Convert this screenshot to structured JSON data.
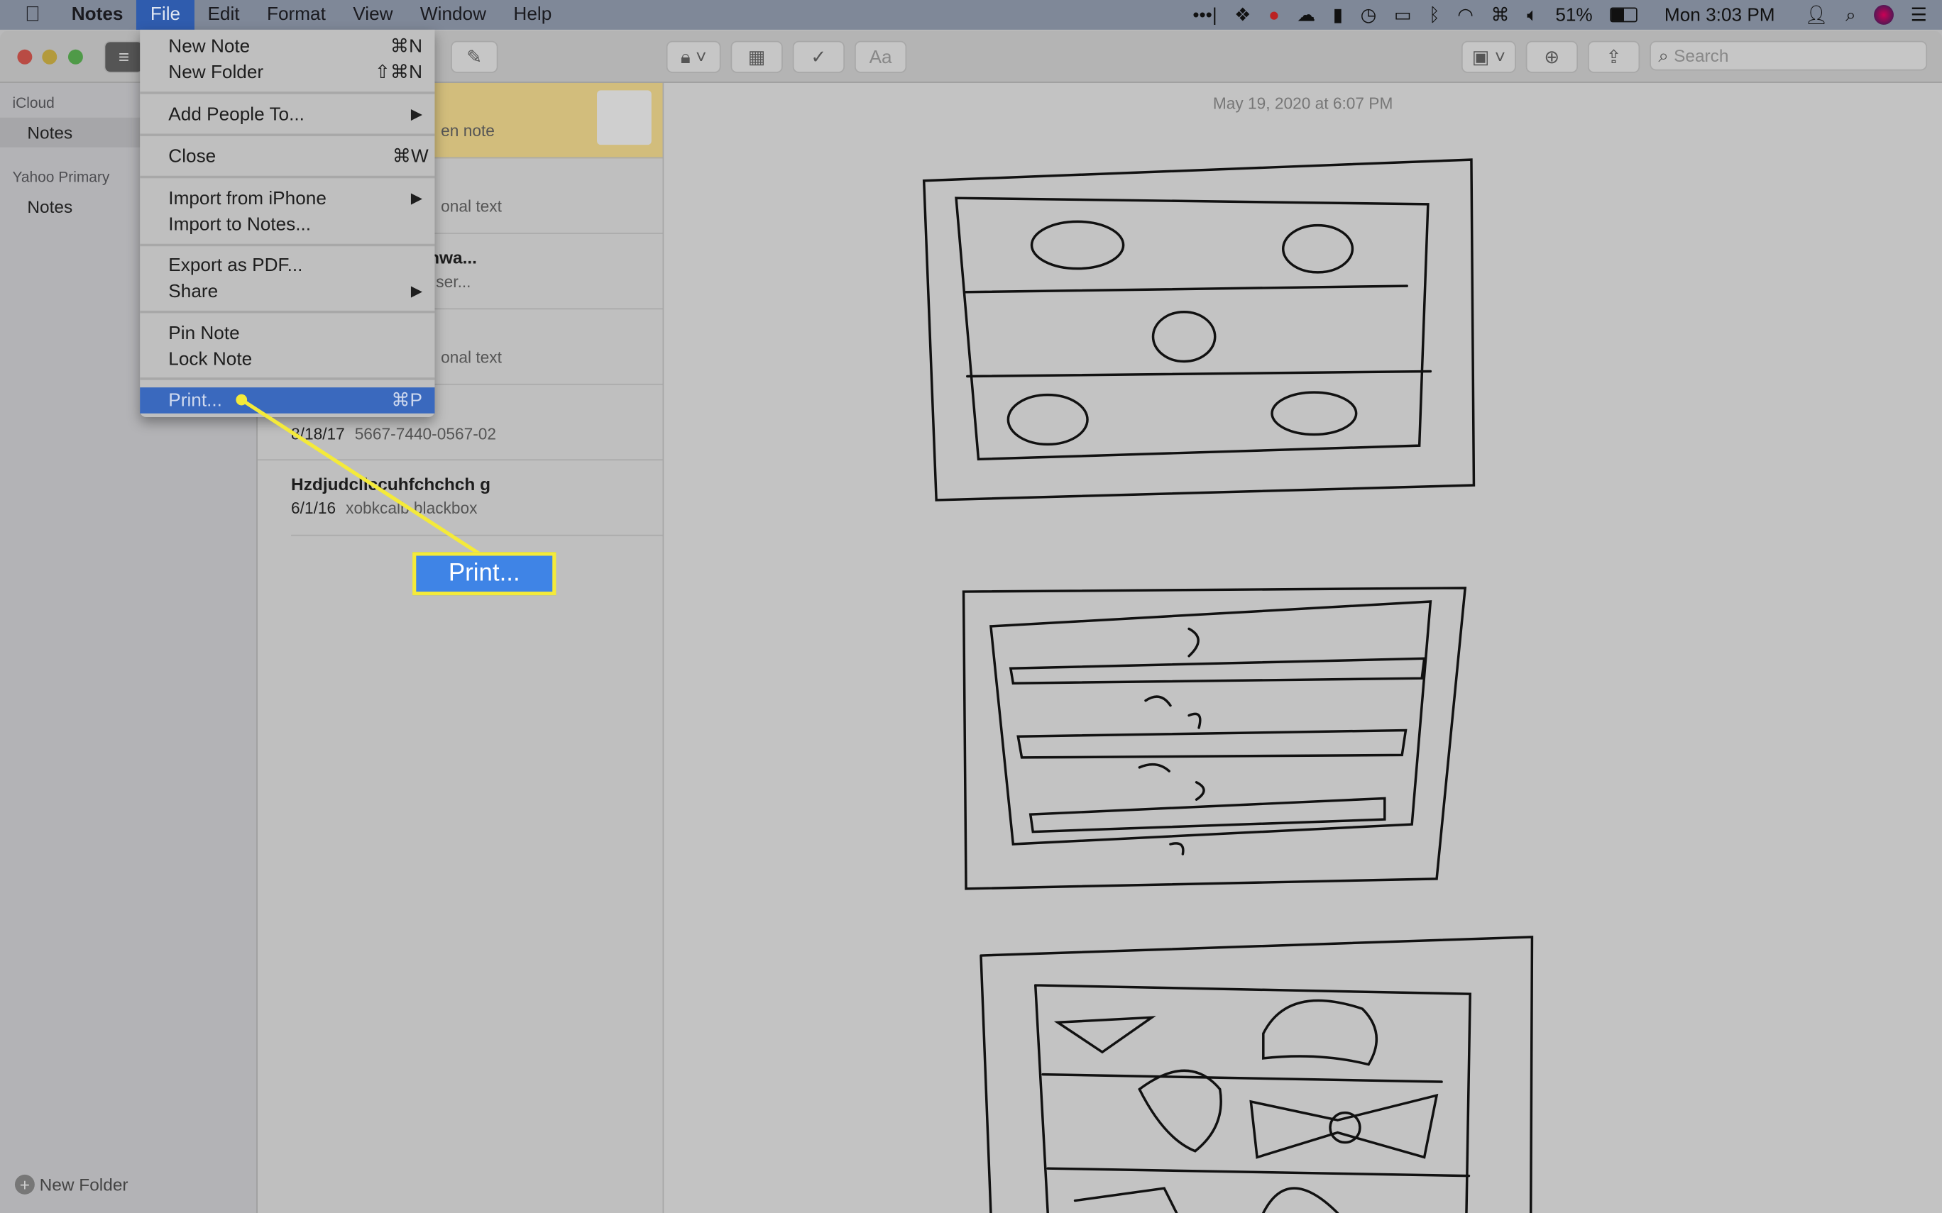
{
  "menubar": {
    "app": "Notes",
    "items": [
      "File",
      "Edit",
      "Format",
      "View",
      "Window",
      "Help"
    ],
    "active": "File",
    "status": {
      "battery": "51%",
      "clock": "Mon 3:03 PM"
    }
  },
  "toolbar": {
    "search_placeholder": "Search",
    "format_label": "Aa"
  },
  "sidebar": {
    "groups": [
      {
        "header": "iCloud",
        "items": [
          "Notes"
        ]
      },
      {
        "header": "Yahoo Primary",
        "items": [
          "Notes"
        ]
      }
    ],
    "new_folder": "New Folder"
  },
  "notes": [
    {
      "title": "",
      "snippet": "en note",
      "selected": true
    },
    {
      "title": "",
      "snippet": "onal text"
    },
    {
      "title": "ing down the highwa...",
      "snippet": "miles to the nearest ser..."
    },
    {
      "title": "",
      "snippet": "onal text"
    },
    {
      "title": "",
      "date": "8/18/17",
      "snippet": "5667-7440-0567-02"
    },
    {
      "title": "Hzdjudcliccuhfchchch g",
      "date": "6/1/16",
      "snippet": "xobkcalb blackbox"
    }
  ],
  "editor": {
    "timestamp": "May 19, 2020 at 6:07 PM"
  },
  "file_menu": [
    {
      "label": "New Note",
      "shortcut": "⌘N"
    },
    {
      "label": "New Folder",
      "shortcut": "⇧⌘N"
    },
    {
      "label": "Add People To...",
      "shortcut": "▶"
    },
    {
      "label": "Close",
      "shortcut": "⌘W"
    },
    {
      "label": "Import from iPhone",
      "shortcut": "▶"
    },
    {
      "label": "Import to Notes...",
      "shortcut": ""
    },
    {
      "label": "Export as PDF...",
      "shortcut": ""
    },
    {
      "label": "Share",
      "shortcut": "▶"
    },
    {
      "label": "Pin Note",
      "shortcut": ""
    },
    {
      "label": "Lock Note",
      "shortcut": ""
    },
    {
      "label": "Print...",
      "shortcut": "⌘P",
      "highlighted": true
    }
  ],
  "callout": {
    "label": "Print...",
    "color": "#f4ea3a"
  }
}
